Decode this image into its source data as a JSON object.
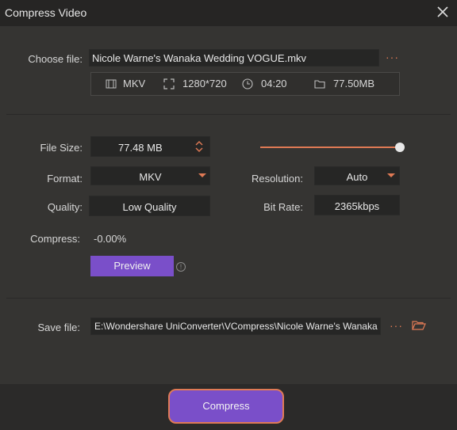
{
  "window": {
    "title": "Compress Video"
  },
  "choose_file": {
    "label": "Choose file:",
    "filename": "Nicole Warne's Wanaka Wedding  VOGUE.mkv",
    "more": "···"
  },
  "file_info": {
    "format": "MKV",
    "resolution": "1280*720",
    "duration": "04:20",
    "size": "77.50MB",
    "icons": [
      "film-icon",
      "resize-icon",
      "clock-icon",
      "folder-icon"
    ]
  },
  "settings": {
    "file_size_label": "File Size:",
    "file_size_value": "77.48  MB",
    "format_label": "Format:",
    "format_value": "MKV",
    "resolution_label": "Resolution:",
    "resolution_value": "Auto",
    "quality_label": "Quality:",
    "quality_value": "Low Quality",
    "bitrate_label": "Bit Rate:",
    "bitrate_value": "2365kbps",
    "compress_label": "Compress:",
    "compress_value": "-0.00%",
    "slider_level": 1.0,
    "preview_label": "Preview",
    "help_glyph": "!"
  },
  "save_file": {
    "label": "Save file:",
    "path": "E:\\Wondershare UniConverter\\VCompress\\Nicole Warne's Wanaka",
    "more": "···"
  },
  "footer": {
    "compress_label": "Compress"
  },
  "colors": {
    "accent": "#e07a55",
    "button": "#7a4fc9",
    "background": "#353432"
  }
}
